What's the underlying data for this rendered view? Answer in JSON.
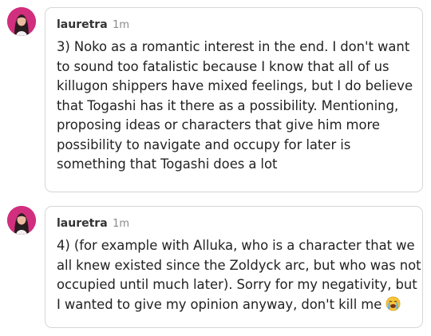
{
  "posts": [
    {
      "username": "lauretra",
      "timestamp": "1m",
      "lines": [
        "3) Noko as a romantic interest in the end. I don't want",
        "to sound too fatalistic because I know that all of us",
        "killugon shippers have mixed feelings, but I do believe",
        "that Togashi has it there as a possibility. Mentioning,",
        "proposing ideas or characters that give him more",
        "possibility to navigate and occupy for later is",
        "something that Togashi does a lot"
      ]
    },
    {
      "username": "lauretra",
      "timestamp": "1m",
      "lines": [
        "4) (for example with Alluka, who is a character that we",
        "all knew existed since the Zoldyck arc, but who was not",
        "occupied until much later). Sorry for my negativity, but",
        "I wanted to give my opinion anyway, don't kill me"
      ],
      "trailing_emoji": "loudly-crying-face-icon"
    }
  ],
  "colors": {
    "avatar_bg": "#d12e7e",
    "bubble_border": "#d6d6d6",
    "text": "#222222",
    "timestamp": "#8a8a8a"
  }
}
